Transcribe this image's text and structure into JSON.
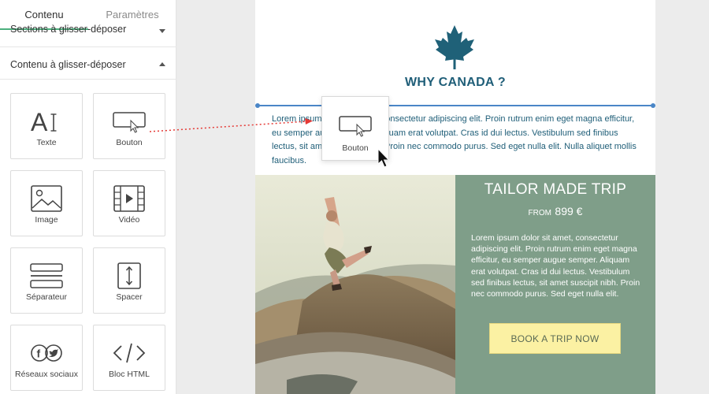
{
  "sidebar": {
    "tabs": [
      {
        "label": "Contenu",
        "active": true
      },
      {
        "label": "Paramètres",
        "active": false
      }
    ],
    "sections_label": "Sections à glisser-déposer",
    "content_label": "Contenu à glisser-déposer",
    "tiles": [
      {
        "label": "Texte",
        "icon": "text-icon"
      },
      {
        "label": "Bouton",
        "icon": "button-icon"
      },
      {
        "label": "Image",
        "icon": "image-icon"
      },
      {
        "label": "Vidéo",
        "icon": "video-icon"
      },
      {
        "label": "Séparateur",
        "icon": "divider-icon"
      },
      {
        "label": "Spacer",
        "icon": "spacer-icon"
      },
      {
        "label": "Réseaux sociaux",
        "icon": "social-icon"
      },
      {
        "label": "Bloc HTML",
        "icon": "html-icon"
      }
    ],
    "accent_color": "#4caf7d"
  },
  "canvas": {
    "headline": "WHY CANADA ?",
    "body_lines": [
      "Lorem ipsum dolor sit amet, consectetur adipiscing elit. Proin rutrum enim eget magna efficitur,",
      "eu semper augue semper. Aliquam erat volutpat. Cras id dui lectus. Vestibulum sed finibus",
      "lectus, sit amet suscipit nibh. Proin nec commodo purus. Sed eget nulla elit. Nulla aliquet mollis",
      "faucibus."
    ],
    "trip": {
      "title": "TAILOR MADE TRIP",
      "from_word": "FROM",
      "price": "899 €",
      "text": "Lorem ipsum dolor sit amet, consectetur adipiscing elit. Proin rutrum enim eget magna efficitur, eu semper augue semper. Aliquam erat volutpat. Cras id dui lectus. Vestibulum sed finibus lectus, sit amet suscipit nibh. Proin nec commodo purus. Sed eget nulla elit.",
      "cta_label": "BOOK A TRIP NOW"
    },
    "colors": {
      "headline": "#1f5e78",
      "panel": "#7f9e89",
      "cta": "#fbf1a3",
      "drop_indicator": "#4a86c7"
    }
  },
  "drag": {
    "ghost_label": "Bouton",
    "ghost_icon": "button-icon"
  }
}
